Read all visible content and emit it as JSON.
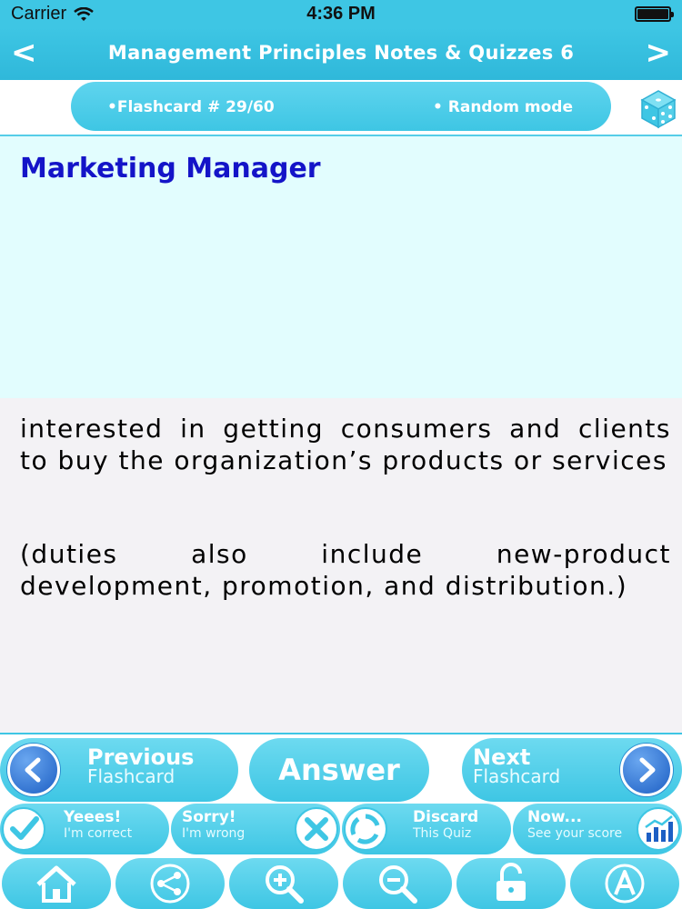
{
  "status_bar": {
    "carrier": "Carrier",
    "time": "4:36 PM"
  },
  "nav": {
    "back": "<",
    "title": "Management Principles Notes & Quizzes 6",
    "forward": ">"
  },
  "info": {
    "flashcard": "•Flashcard #  29/60",
    "mode": "• Random mode"
  },
  "card": {
    "term": "Marketing Manager",
    "answer_p1": "interested in getting consumers and clients to buy the organization’s products or services",
    "answer_p2": "(duties also include new-product development, promotion, and distribution.)"
  },
  "controls": {
    "prev_label": "Previous",
    "prev_sub": "Flashcard",
    "answer": "Answer",
    "next_label": "Next",
    "next_sub": "Flashcard"
  },
  "score_buttons": [
    {
      "label": "Yeees!",
      "sub": "I'm correct"
    },
    {
      "label": "Sorry!",
      "sub": "I'm wrong"
    },
    {
      "label": "Discard",
      "sub": "This Quiz"
    },
    {
      "label": "Now...",
      "sub": "See your score"
    }
  ],
  "colors": {
    "accent": "#3ec6e4",
    "term": "#1414c8",
    "question_bg": "#e2fdfe",
    "answer_bg": "#f3f2f5"
  },
  "toolbar_icons": [
    "home-icon",
    "share-icon",
    "zoom-in-icon",
    "zoom-out-icon",
    "lock-icon",
    "font-icon"
  ]
}
